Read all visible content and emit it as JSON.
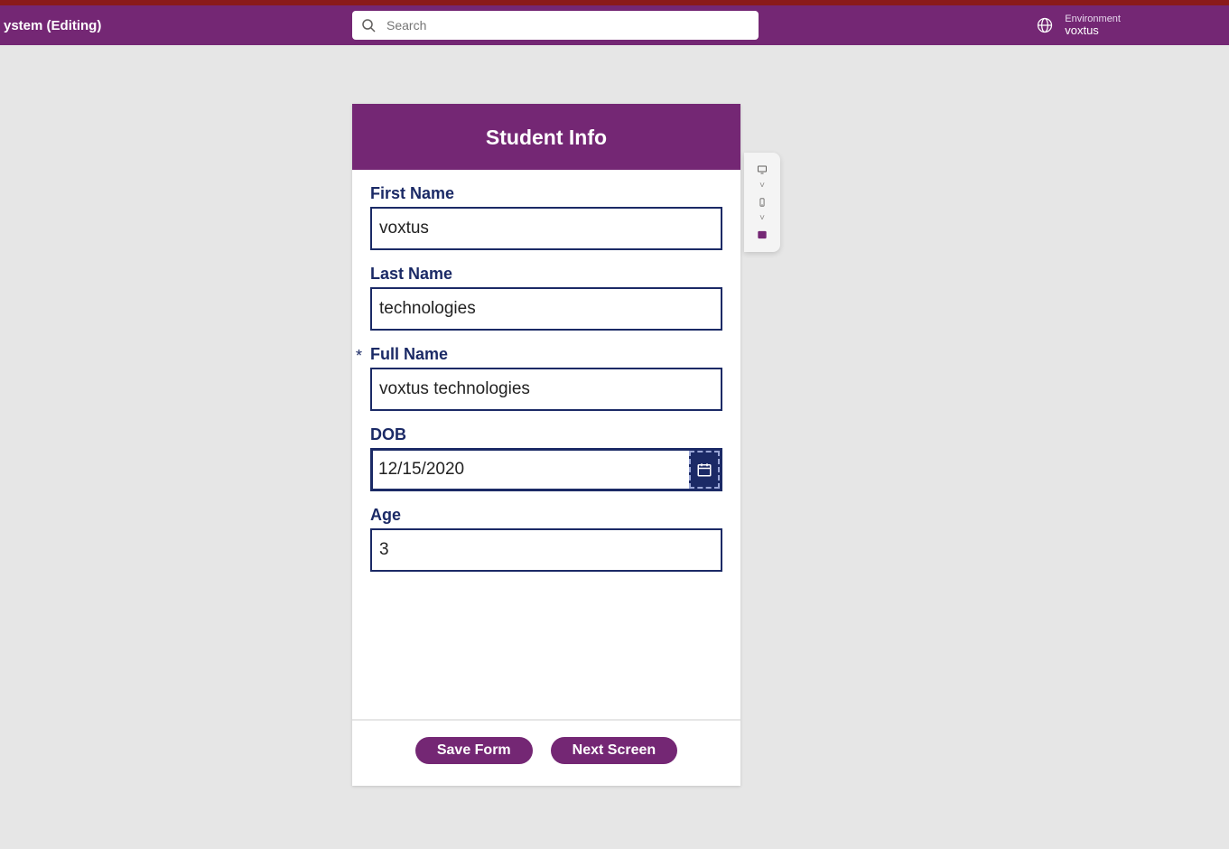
{
  "topbar": {
    "title": "ystem (Editing)",
    "search_placeholder": "Search",
    "env_label": "Environment",
    "env_value": "voxtus"
  },
  "form": {
    "header": "Student Info",
    "fields": {
      "first_name": {
        "label": "First Name",
        "value": "voxtus"
      },
      "last_name": {
        "label": "Last Name",
        "value": "technologies"
      },
      "full_name": {
        "label": "Full Name",
        "value": "voxtus technologies"
      },
      "dob": {
        "label": "DOB",
        "value": "12/15/2020"
      },
      "age": {
        "label": "Age",
        "value": "3"
      }
    },
    "buttons": {
      "save": "Save Form",
      "next": "Next Screen"
    }
  }
}
